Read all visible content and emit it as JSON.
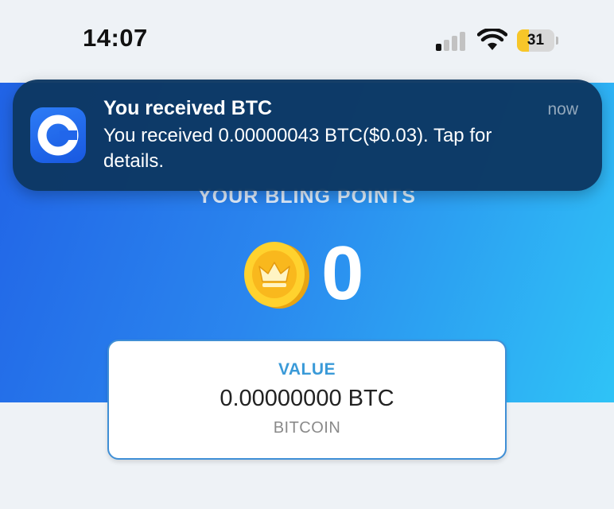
{
  "status_bar": {
    "time": "14:07",
    "battery_level": "31",
    "battery_color": "#f7c629",
    "signal_bars_active": 1,
    "signal_bars_total": 4
  },
  "notification": {
    "app_icon": "coinbase-icon",
    "title": "You received BTC",
    "time": "now",
    "body": "You received 0.00000043 BTC($0.03). Tap for details."
  },
  "hero": {
    "title": "YOUR BLING POINTS",
    "points": "0",
    "coin_icon": "crown-coin-icon"
  },
  "value_card": {
    "label": "VALUE",
    "amount": "0.00000000 BTC",
    "currency": "BITCOIN"
  }
}
